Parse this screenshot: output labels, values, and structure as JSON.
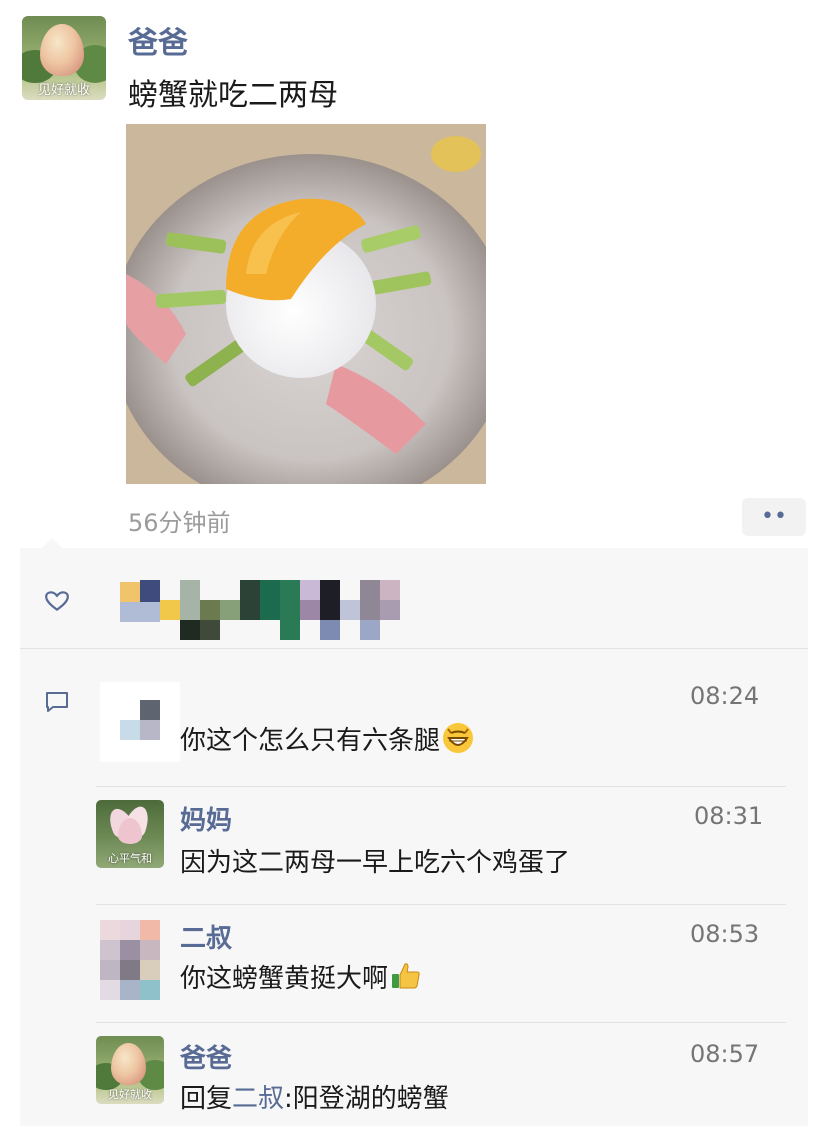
{
  "post": {
    "author": "爸爸",
    "avatar_caption": "见好就收",
    "text": "螃蟹就吃二两母",
    "time_ago": "56分钟前",
    "more_label": "••"
  },
  "comments": [
    {
      "author": "",
      "time": "08:24",
      "text": "你这个怎么只有六条腿",
      "emoji": "grinning-face-emoji"
    },
    {
      "author": "妈妈",
      "avatar_caption": "心平气和",
      "time": "08:31",
      "text": "因为这二两母一早上吃六个鸡蛋了"
    },
    {
      "author": "二叔",
      "time": "08:53",
      "text": "你这螃蟹黄挺大啊",
      "emoji": "thumbs-up-emoji"
    },
    {
      "author": "爸爸",
      "avatar_caption": "见好就收",
      "time": "08:57",
      "reply_prefix": "回复",
      "reply_to": "二叔",
      "reply_sep": ":",
      "text": "阳登湖的螃蟹"
    }
  ],
  "colors": {
    "name_link": "#576b95",
    "interaction_bg": "#f7f7f7"
  }
}
